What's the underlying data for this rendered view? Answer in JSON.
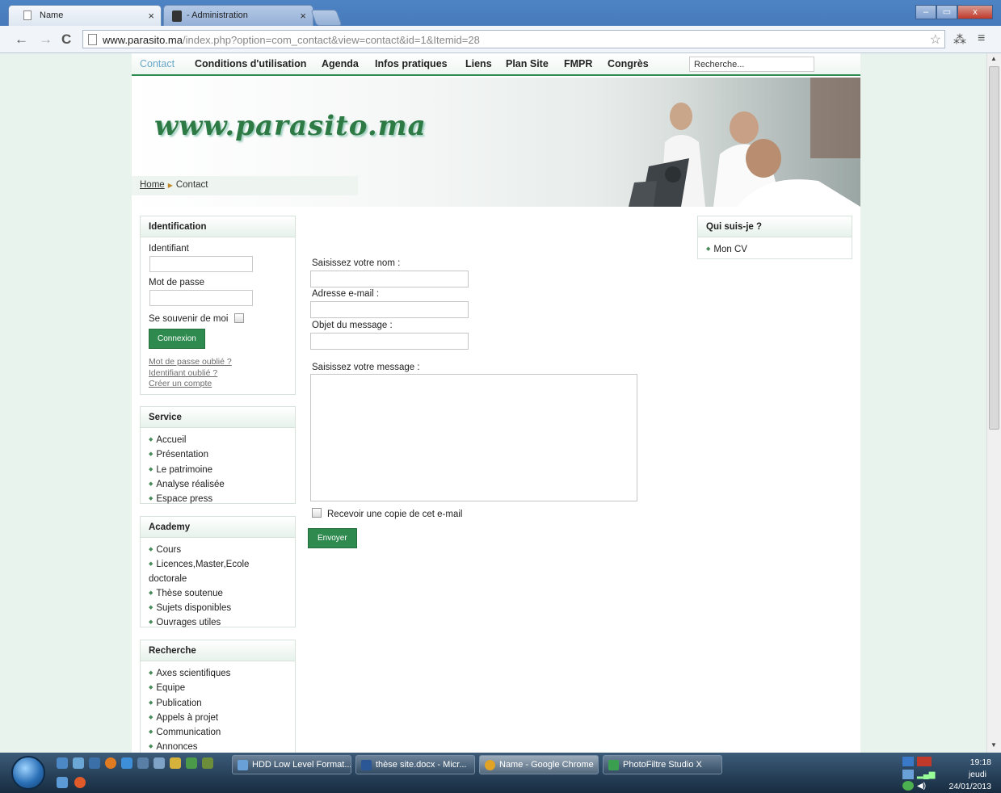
{
  "browser": {
    "tabs": [
      {
        "title": "Name",
        "close": "×"
      },
      {
        "title": "- Administration",
        "close": "×"
      }
    ],
    "url_host": "www.parasito.ma",
    "url_path": "/index.php?option=com_contact&view=contact&id=1&Itemid=28",
    "nav": {
      "back": "←",
      "forward": "→",
      "reload": "C"
    },
    "window_controls": {
      "minimize": "–",
      "maximize": "▭",
      "close": "x"
    }
  },
  "topnav": {
    "items": [
      "Contact",
      "Conditions d'utilisation",
      "Agenda",
      "Infos pratiques",
      "Liens",
      "Plan Site",
      "FMPR",
      "Congrès"
    ],
    "search_placeholder": "Recherche..."
  },
  "banner": {
    "logo": "www.parasito.ma",
    "breadcrumb_home": "Home",
    "breadcrumb_current": "Contact"
  },
  "identification": {
    "title": "Identification",
    "username_label": "Identifiant",
    "password_label": "Mot de passe",
    "remember_label": "Se souvenir de moi",
    "login_button": "Connexion",
    "forgot_password": "Mot de passe oublié ?",
    "forgot_username": "Identifiant oublié ?",
    "create_account": "Créer un compte"
  },
  "service": {
    "title": "Service",
    "items": [
      "Accueil",
      "Présentation",
      "Le patrimoine",
      "Analyse réalisée",
      "Espace press"
    ]
  },
  "academy": {
    "title": "Academy",
    "items": [
      "Cours",
      "Licences,Master,Ecole",
      "doctorale",
      "Thèse soutenue",
      "Sujets disponibles",
      "Ouvrages utiles"
    ]
  },
  "recherche": {
    "title": "Recherche",
    "items": [
      "Axes scientifiques",
      "Equipe",
      "Publication",
      "Appels à projet",
      "Communication",
      "Annonces"
    ]
  },
  "quisuisje": {
    "title": "Qui suis-je ?",
    "items": [
      "Mon CV"
    ]
  },
  "contact_form": {
    "name_label": "Saisissez votre nom :",
    "email_label": "Adresse e-mail :",
    "subject_label": "Objet du message :",
    "message_label": "Saisissez votre message :",
    "copy_label": "Recevoir une copie de cet e-mail",
    "send_button": "Envoyer"
  },
  "taskbar": {
    "tasks": [
      {
        "label": "HDD Low Level Format...",
        "color": "#6aa0d8"
      },
      {
        "label": "thèse site.docx - Micr...",
        "color": "#2b5797"
      },
      {
        "label": "Name - Google Chrome",
        "color": "#e0a325"
      },
      {
        "label": "PhotoFiltre Studio X",
        "color": "#3aa050"
      }
    ],
    "time": "19:18",
    "day": "jeudi",
    "date": "24/01/2013"
  }
}
